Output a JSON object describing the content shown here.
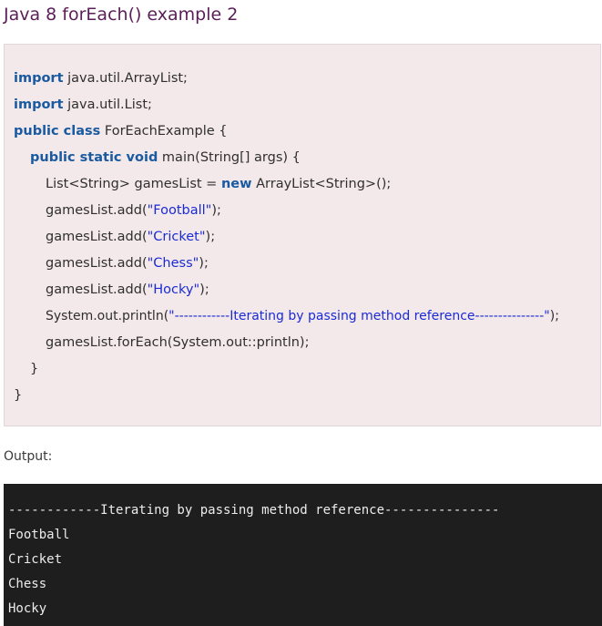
{
  "title": "Java 8 forEach() example 2",
  "code": {
    "line1": {
      "kw": "import",
      "rest": " java.util.ArrayList;"
    },
    "line2": {
      "kw": "import",
      "rest": " java.util.List;"
    },
    "line3": {
      "kw": "public class",
      "rest": " ForEachExample {"
    },
    "line4": {
      "kw": "public static void",
      "rest": " main(String[] args) {"
    },
    "line5": {
      "pre": "List<String> gamesList = ",
      "kw": "new",
      "rest": " ArrayList<String>();"
    },
    "line6": {
      "pre": "gamesList.add(",
      "str": "\"Football\"",
      "rest": ");"
    },
    "line7": {
      "pre": "gamesList.add(",
      "str": "\"Cricket\"",
      "rest": ");"
    },
    "line8": {
      "pre": "gamesList.add(",
      "str": "\"Chess\"",
      "rest": ");"
    },
    "line9": {
      "pre": "gamesList.add(",
      "str": "\"Hocky\"",
      "rest": ");"
    },
    "line10": {
      "pre": "System.out.println(",
      "str": "\"------------Iterating by passing method reference---------------\"",
      "rest": ");"
    },
    "line11": {
      "pre": "gamesList.forEach(System.out::println);"
    },
    "line12": {
      "pre": "}"
    },
    "line13": {
      "pre": "}"
    }
  },
  "output_label": "Output:",
  "console": [
    "------------Iterating by passing method reference---------------",
    "Football",
    "Cricket",
    "Chess",
    "Hocky"
  ]
}
